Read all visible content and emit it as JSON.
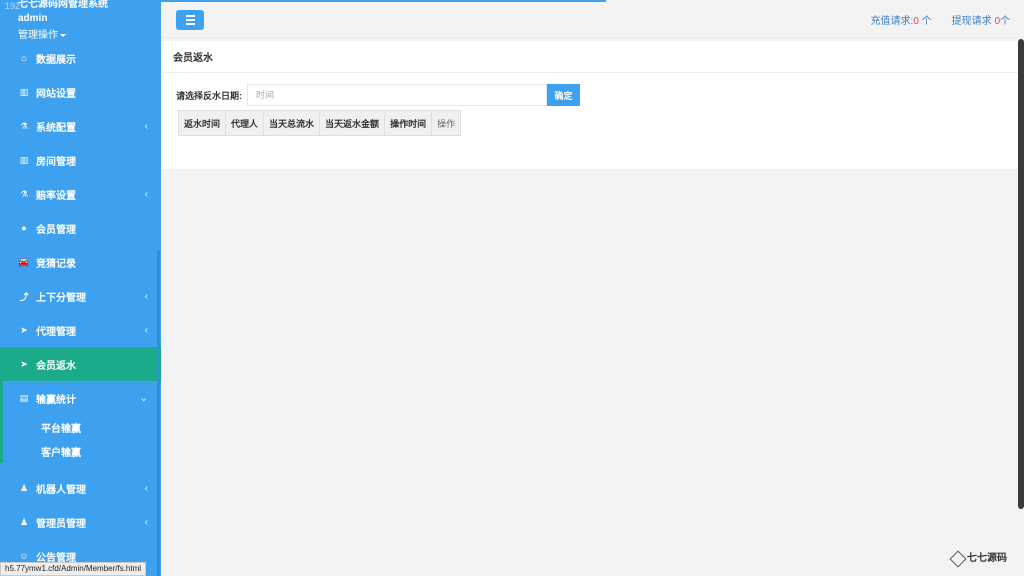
{
  "sidebar": {
    "ghost_text": "192",
    "system_title": "七七源码网管理系统",
    "user": "admin",
    "ops_label": "管理操作",
    "items": [
      {
        "label": "数据展示",
        "icon": "home-icon",
        "glyph": "⌂",
        "arrow": ""
      },
      {
        "label": "网站设置",
        "icon": "columns-icon",
        "glyph": "▥",
        "arrow": ""
      },
      {
        "label": "系统配置",
        "icon": "flask-icon",
        "glyph": "⚗",
        "arrow": "‹"
      },
      {
        "label": "房间管理",
        "icon": "columns-icon",
        "glyph": "▥",
        "arrow": ""
      },
      {
        "label": "赔率设置",
        "icon": "flask-icon",
        "glyph": "⚗",
        "arrow": "‹"
      },
      {
        "label": "会员管理",
        "icon": "user-icon",
        "glyph": "●",
        "arrow": ""
      },
      {
        "label": "竞猜记录",
        "icon": "car-icon",
        "glyph": "🚘",
        "arrow": ""
      },
      {
        "label": "上下分管理",
        "icon": "level-up-icon",
        "glyph": "⤴",
        "arrow": "‹"
      },
      {
        "label": "代理管理",
        "icon": "paper-plane-icon",
        "glyph": "➤",
        "arrow": "‹"
      },
      {
        "label": "会员返水",
        "icon": "paper-plane-icon",
        "glyph": "➤",
        "arrow": ""
      },
      {
        "label": "输赢统计",
        "icon": "bar-chart-icon",
        "glyph": "▤",
        "arrow": "⌄"
      }
    ],
    "sub_items": [
      "平台输赢",
      "客户输赢"
    ],
    "items_after": [
      {
        "label": "机器人管理",
        "icon": "male-icon",
        "glyph": "♟",
        "arrow": "‹"
      },
      {
        "label": "管理员管理",
        "icon": "male-icon",
        "glyph": "♟",
        "arrow": "‹"
      },
      {
        "label": "公告管理",
        "icon": "comment-icon",
        "glyph": "☺",
        "arrow": ""
      }
    ]
  },
  "status_url": "h5.77ymw1.cfd/Admin/Member/fs.html",
  "topbar": {
    "recharge_label": "充值请求:",
    "recharge_count": "0",
    "recharge_unit": " 个",
    "withdraw_label": "提现请求 ",
    "withdraw_count": "0",
    "withdraw_unit": "个"
  },
  "panel": {
    "title": "会员返水",
    "date_label": "请选择反水日期:",
    "date_placeholder": "时间",
    "ok_label": "确定",
    "columns": [
      "返水时间",
      "代理人",
      "当天总流水",
      "当天返水金额",
      "操作时间",
      "操作"
    ]
  },
  "logo": {
    "text": "七七源码"
  },
  "colors": {
    "sidebar": "#3ea1f0",
    "active": "#1aab8b",
    "count": "#e8414b"
  }
}
